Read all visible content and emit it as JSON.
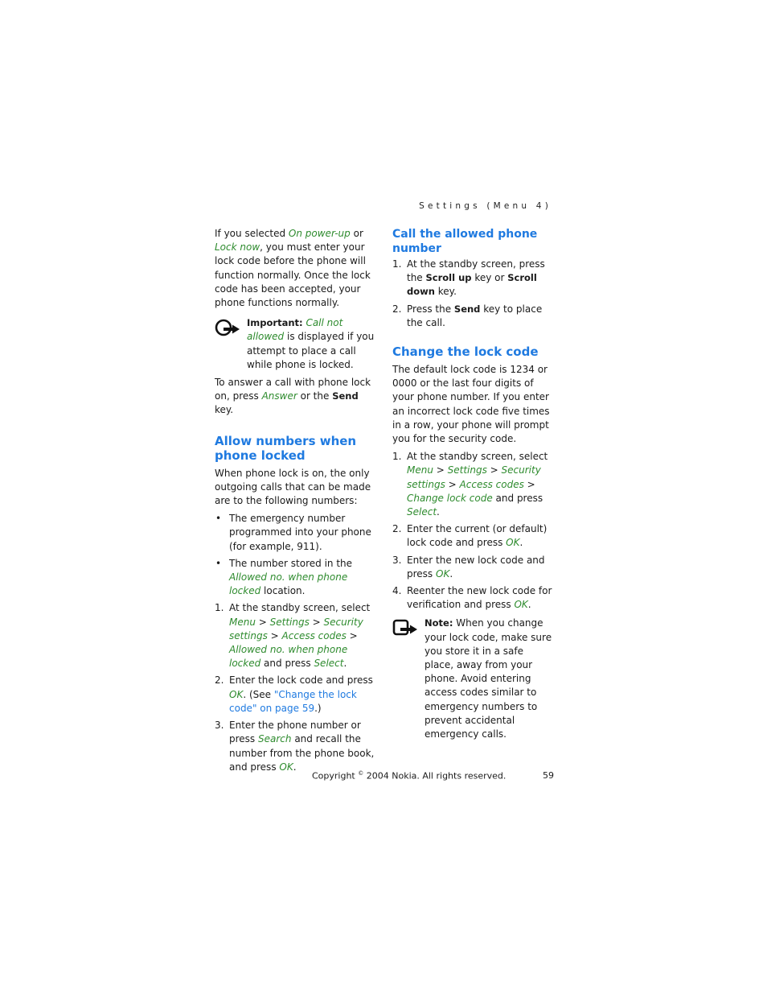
{
  "header": {
    "running_title": "Settings (Menu 4)"
  },
  "left": {
    "intro": {
      "t1": "If you selected ",
      "g1": "On power-up",
      "t2": " or ",
      "g2": "Lock now",
      "t3": ", you must enter your lock code before the phone will function normally. Once the lock code has been accepted, your phone functions normally."
    },
    "important": {
      "label": "Important:",
      "g1": "Call not allowed",
      "t1": " is displayed if you attempt to place a call while phone is locked."
    },
    "answer": {
      "t1": "To answer a call with phone lock on, press ",
      "g1": "Answer",
      "t2": " or the ",
      "b1": "Send",
      "t3": " key."
    },
    "allow_heading": "Allow numbers when phone locked",
    "allow_intro": "When phone lock is on, the only outgoing calls that can be made are to the following numbers:",
    "bullets": {
      "bullet_char": "•",
      "b1": "The emergency number programmed into your phone (for example, 911).",
      "b2_t1": "The number stored in the ",
      "b2_g1": "Allowed no. when phone locked",
      "b2_t2": " location."
    },
    "steps": {
      "s1_num": "1.",
      "s1_t1": "At the standby screen, select ",
      "s1_g1": "Menu",
      "s1_g2": "Settings",
      "s1_g3": "Security settings",
      "s1_g4": "Access codes",
      "s1_g5": "Allowed no. when phone locked",
      "s1_t2": " and press ",
      "s1_g6": "Select",
      "sep": " > ",
      "s2_num": "2.",
      "s2_t1": "Enter the lock code and press ",
      "s2_g1": "OK",
      "s2_t2": ". (See ",
      "s2_link": "\"Change the lock code\" on page 59",
      "s2_t3": ".)",
      "s3_num": "3.",
      "s3_t1": "Enter the phone number or press ",
      "s3_g1": "Search",
      "s3_t2": " and recall the number from the phone book, and press ",
      "s3_g2": "OK",
      "period": "."
    }
  },
  "right": {
    "call_heading": "Call the allowed phone number",
    "call_steps": {
      "s1_num": "1.",
      "s1_t1": "At the standby screen, press the ",
      "s1_b1": "Scroll up",
      "s1_t2": " key or ",
      "s1_b2": "Scroll down",
      "s1_t3": " key.",
      "s2_num": "2.",
      "s2_t1": "Press the ",
      "s2_b1": "Send",
      "s2_t2": " key to place the call."
    },
    "change_heading": "Change the lock code",
    "change_intro": "The default lock code is 1234 or 0000 or the last four digits of your phone number. If you enter an incorrect lock code five times in a row, your phone will prompt you for the security code.",
    "change_steps": {
      "s1_num": "1.",
      "s1_t1": "At the standby screen, select ",
      "s1_g1": "Menu",
      "s1_g2": "Settings",
      "s1_g3": "Security settings",
      "s1_g4": "Access codes",
      "s1_g5": "Change lock code",
      "s1_t2": " and press ",
      "s1_g6": "Select",
      "sep": " > ",
      "s2_num": "2.",
      "s2_t1": "Enter the current (or default) lock code and press ",
      "s2_g1": "OK",
      "s3_num": "3.",
      "s3_t1": "Enter the new lock code and press ",
      "s3_g1": "OK",
      "s4_num": "4.",
      "s4_t1": "Reenter the new lock code for verification and press ",
      "s4_g1": "OK",
      "period": "."
    },
    "note": {
      "label": "Note:",
      "t1": " When you change your lock code, make sure you store it in a safe place, away from your phone. Avoid entering access codes similar to emergency numbers to prevent accidental emergency calls."
    }
  },
  "footer": {
    "copyright_pre": "Copyright ",
    "copyright_symbol": "©",
    "copyright_post": " 2004 Nokia. All rights reserved.",
    "page_number": "59"
  },
  "icons": {
    "important": "important-icon",
    "note": "note-icon"
  },
  "colors": {
    "heading": "#1f7ae0",
    "menu_term": "#2e8b2e",
    "body": "#1a1a1a"
  }
}
